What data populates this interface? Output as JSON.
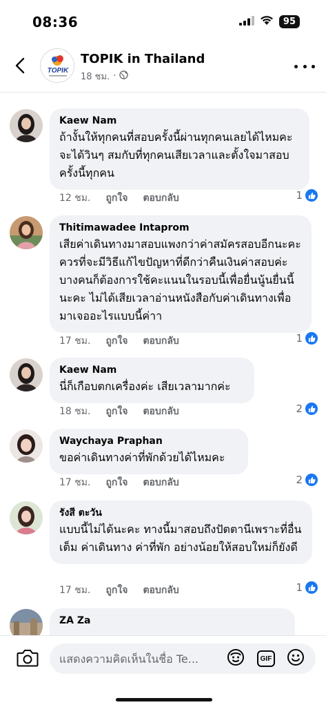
{
  "status_bar": {
    "time": "08:36",
    "battery": "95"
  },
  "header": {
    "page_name": "TOPIK in Thailand",
    "post_age": "18 ชม.",
    "logo_text": "TOPIK"
  },
  "comments": [
    {
      "author": "Kaew Nam",
      "text": "ถ้างั้นให้ทุกคนที่สอบครั้งนี้ผ่านทุกคนเลยได้ไหมคะ จะได้วินๆ สมกับที่ทุกคนเสียเวลาและตั้งใจมาสอบครั้งนี้ทุกคน",
      "time": "12 ชม.",
      "like_label": "ถูกใจ",
      "reply_label": "ตอบกลับ",
      "reaction_count": "1"
    },
    {
      "author": "Thitimawadee Intaprom",
      "text": "เสียค่าเดินทางมาสอบแพงกว่าค่าสมัครสอบอีกนะคะ ควรที่จะมีวิธีแก้ไขปัญหาที่ดีกว่าคืนเงินค่าสอบค่ะ บางคนก็ต้องการใช้คะแนนในรอบนี้เพื่อยื่นนู้นยื่นนี้นะคะ ไม่ได้เสียเวลาอ่านหนังสือกับค่าเดินทางเพื่อมาเจออะไรแบบนี้ค่าา",
      "time": "17 ชม.",
      "like_label": "ถูกใจ",
      "reply_label": "ตอบกลับ",
      "reaction_count": "1"
    },
    {
      "author": "Kaew Nam",
      "text": "นี่ก็เกือบตกเครื่องค่ะ เสียเวลามากค่ะ",
      "time": "18 ชม.",
      "like_label": "ถูกใจ",
      "reply_label": "ตอบกลับ",
      "reaction_count": "2"
    },
    {
      "author": "Waychaya Praphan",
      "text": "ขอค่าเดินทางค่าที่พักด้วยได้ไหมคะ",
      "time": "17 ชม.",
      "like_label": "ถูกใจ",
      "reply_label": "ตอบกลับ",
      "reaction_count": "2"
    },
    {
      "author": "รังสี ตะวัน",
      "text": "แบบนี้ไม่ได้นะคะ ทางนี้มาสอบถึงปัตตานีเพราะที่อื่นเต็ม ค่าเดินทาง ค่าที่พัก อย่างน้อยให้สอบใหม่ก็ยังดี",
      "time": "17 ชม.",
      "like_label": "ถูกใจ",
      "reply_label": "ตอบกลับ",
      "reaction_count": "1"
    },
    {
      "author": "ZA Za",
      "text": "",
      "time": "",
      "like_label": "",
      "reply_label": "",
      "reaction_count": ""
    }
  ],
  "composer": {
    "placeholder": "แสดงความคิดเห็นในชื่อ Te...",
    "gif_label": "GIF"
  },
  "colors": {
    "like_blue": "#1877f2",
    "bubble_bg": "#f0f2f5",
    "secondary_text": "#65676b"
  },
  "icons": [
    "back-arrow-icon",
    "globe-icon",
    "more-icon",
    "like-icon",
    "camera-icon",
    "avatar-sticker-icon",
    "gif-icon",
    "emoji-icon",
    "signal-icon",
    "wifi-icon"
  ]
}
